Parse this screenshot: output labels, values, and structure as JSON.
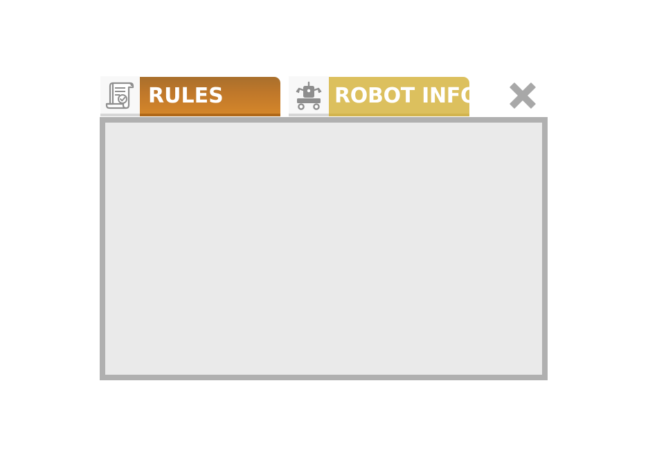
{
  "tabs": [
    {
      "label": "RULES",
      "icon": "scroll-certificate-icon",
      "color": "#c0782a"
    },
    {
      "label": "ROBOT INFO",
      "icon": "robot-icon",
      "color": "#dcc05e"
    }
  ],
  "close": {
    "icon": "close-x-icon",
    "color": "#a8a8a8"
  },
  "panel": {
    "background": "#eaeaea",
    "border_color": "#b0b0b0",
    "content": ""
  }
}
